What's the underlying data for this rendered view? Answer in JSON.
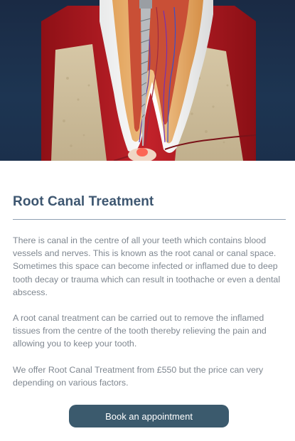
{
  "hero": {
    "image": "root-canal-tooth-illustration"
  },
  "section": {
    "title": "Root Canal Treatment",
    "paragraphs": [
      "There is canal in the centre of all your teeth which contains blood vessels and nerves. This is known as the root canal or canal space. Sometimes this space can become infected or inflamed due to deep tooth decay or trauma which can result in toothache or even a dental abscess.",
      "A root canal treatment can be carried out to remove the inflamed tissues from the centre of the tooth thereby relieving the pain and allowing you to keep your tooth.",
      "We offer Root Canal Treatment from £550 but the price can very depending on various factors."
    ]
  },
  "cta": {
    "label": "Book an appointment"
  },
  "colors": {
    "title": "#3d5670",
    "button_bg": "#3b5a6d",
    "body_text": "#7f8790",
    "hero_bg": "#1a2a44"
  }
}
